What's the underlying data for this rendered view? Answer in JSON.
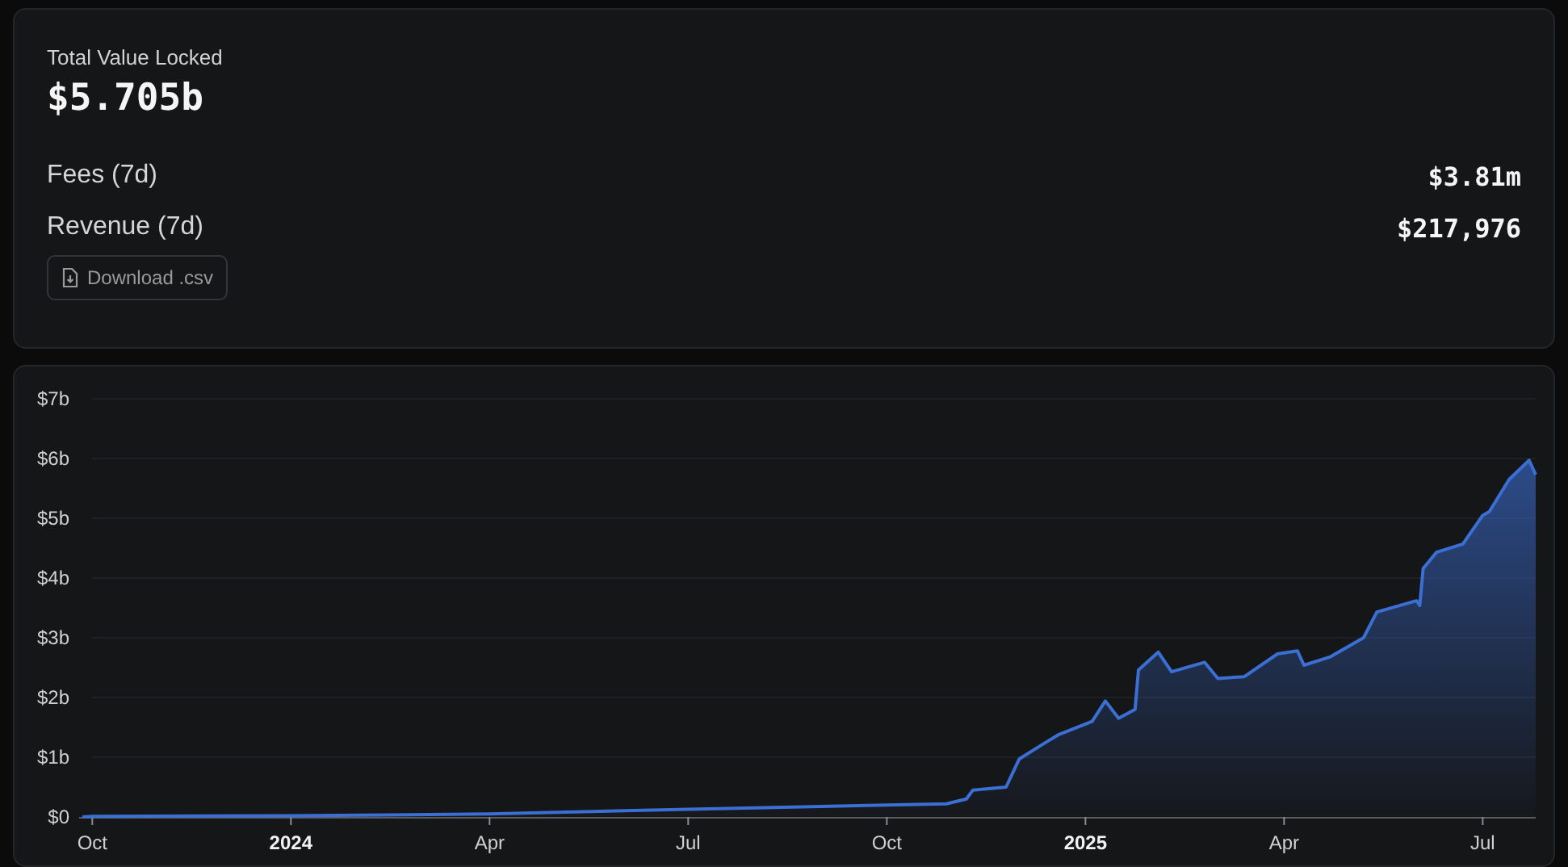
{
  "summary": {
    "title": "Total Value Locked",
    "value": "$5.705b",
    "metrics": [
      {
        "label": "Fees (7d)",
        "value": "$3.81m"
      },
      {
        "label": "Revenue (7d)",
        "value": "$217,976"
      }
    ],
    "download_button": "Download .csv"
  },
  "chart": {
    "chart_data": {
      "type": "area",
      "grid": true,
      "xlim": [
        2023.7375,
        2025.5667
      ],
      "ylim": [
        0,
        7
      ],
      "yticks": [
        {
          "value": 0,
          "label": "$0"
        },
        {
          "value": 1,
          "label": "$1b"
        },
        {
          "value": 2,
          "label": "$2b"
        },
        {
          "value": 3,
          "label": "$3b"
        },
        {
          "value": 4,
          "label": "$4b"
        },
        {
          "value": 5,
          "label": "$5b"
        },
        {
          "value": 6,
          "label": "$6b"
        },
        {
          "value": 7,
          "label": "$7b"
        }
      ],
      "xticks": [
        {
          "value": 2023.75,
          "label": "Oct"
        },
        2024,
        {
          "value": 2024.25,
          "label": "Apr"
        },
        {
          "value": 2024.5,
          "label": "Jul"
        },
        {
          "value": 2024.75,
          "label": "Oct"
        },
        2025,
        {
          "value": 2025.25,
          "label": "Apr"
        },
        {
          "value": 2025.5,
          "label": "Jul"
        }
      ],
      "x": [
        2023.7375,
        2023.75,
        2024,
        2024.25,
        2024.5,
        2024.75,
        2024.825,
        2024.85,
        2024.8583,
        2024.9,
        2024.9167,
        2024.95,
        2024.9667,
        2025.0083,
        2025.025,
        2025.0417,
        2025.0625,
        2025.0667,
        2025.0917,
        2025.1083,
        2025.15,
        2025.1667,
        2025.2,
        2025.2417,
        2025.2667,
        2025.275,
        2025.3083,
        2025.35,
        2025.3667,
        2025.4167,
        2025.4208,
        2025.425,
        2025.4417,
        2025.475,
        2025.5,
        2025.5083,
        2025.5333,
        2025.5583,
        2025.5667
      ],
      "series": [
        {
          "color": "#3b6fd4",
          "values": [
            0,
            0.01,
            0.02,
            0.05,
            0.13,
            0.2,
            0.22,
            0.3,
            0.45,
            0.5,
            0.97,
            1.25,
            1.38,
            1.6,
            1.94,
            1.65,
            1.8,
            2.46,
            2.76,
            2.43,
            2.59,
            2.32,
            2.35,
            2.73,
            2.78,
            2.54,
            2.68,
            3.0,
            3.43,
            3.62,
            3.54,
            4.16,
            4.43,
            4.57,
            5.05,
            5.11,
            5.65,
            5.97,
            5.73
          ]
        }
      ]
    }
  }
}
